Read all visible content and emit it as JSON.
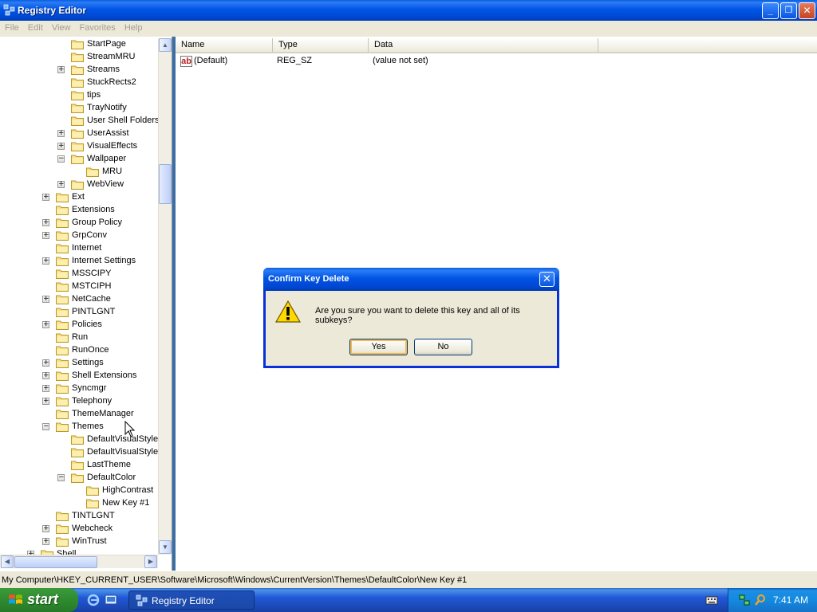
{
  "window": {
    "title": "Registry Editor",
    "minimize": "_",
    "maximize": "❐",
    "close": "✕"
  },
  "menu": [
    "File",
    "Edit",
    "View",
    "Favorites",
    "Help"
  ],
  "tree": [
    {
      "label": "StartPage",
      "indent": 2,
      "expander": ""
    },
    {
      "label": "StreamMRU",
      "indent": 2,
      "expander": ""
    },
    {
      "label": "Streams",
      "indent": 2,
      "expander": "+"
    },
    {
      "label": "StuckRects2",
      "indent": 2,
      "expander": ""
    },
    {
      "label": "tips",
      "indent": 2,
      "expander": ""
    },
    {
      "label": "TrayNotify",
      "indent": 2,
      "expander": ""
    },
    {
      "label": "User Shell Folders",
      "indent": 2,
      "expander": ""
    },
    {
      "label": "UserAssist",
      "indent": 2,
      "expander": "+"
    },
    {
      "label": "VisualEffects",
      "indent": 2,
      "expander": "+"
    },
    {
      "label": "Wallpaper",
      "indent": 2,
      "expander": "−"
    },
    {
      "label": "MRU",
      "indent": 3,
      "expander": ""
    },
    {
      "label": "WebView",
      "indent": 2,
      "expander": "+"
    },
    {
      "label": "Ext",
      "indent": 1,
      "expander": "+"
    },
    {
      "label": "Extensions",
      "indent": 1,
      "expander": ""
    },
    {
      "label": "Group Policy",
      "indent": 1,
      "expander": "+"
    },
    {
      "label": "GrpConv",
      "indent": 1,
      "expander": "+"
    },
    {
      "label": "Internet",
      "indent": 1,
      "expander": ""
    },
    {
      "label": "Internet Settings",
      "indent": 1,
      "expander": "+"
    },
    {
      "label": "MSSCIPY",
      "indent": 1,
      "expander": ""
    },
    {
      "label": "MSTCIPH",
      "indent": 1,
      "expander": ""
    },
    {
      "label": "NetCache",
      "indent": 1,
      "expander": "+"
    },
    {
      "label": "PINTLGNT",
      "indent": 1,
      "expander": ""
    },
    {
      "label": "Policies",
      "indent": 1,
      "expander": "+"
    },
    {
      "label": "Run",
      "indent": 1,
      "expander": ""
    },
    {
      "label": "RunOnce",
      "indent": 1,
      "expander": ""
    },
    {
      "label": "Settings",
      "indent": 1,
      "expander": "+"
    },
    {
      "label": "Shell Extensions",
      "indent": 1,
      "expander": "+"
    },
    {
      "label": "Syncmgr",
      "indent": 1,
      "expander": "+"
    },
    {
      "label": "Telephony",
      "indent": 1,
      "expander": "+"
    },
    {
      "label": "ThemeManager",
      "indent": 1,
      "expander": ""
    },
    {
      "label": "Themes",
      "indent": 1,
      "expander": "−"
    },
    {
      "label": "DefaultVisualStyleOff",
      "indent": 2,
      "expander": ""
    },
    {
      "label": "DefaultVisualStyleOn",
      "indent": 2,
      "expander": ""
    },
    {
      "label": "LastTheme",
      "indent": 2,
      "expander": ""
    },
    {
      "label": "DefaultColor",
      "indent": 2,
      "expander": "−"
    },
    {
      "label": "HighContrast",
      "indent": 3,
      "expander": ""
    },
    {
      "label": "New Key #1",
      "indent": 3,
      "expander": "",
      "selected": true
    },
    {
      "label": "TINTLGNT",
      "indent": 1,
      "expander": ""
    },
    {
      "label": "Webcheck",
      "indent": 1,
      "expander": "+"
    },
    {
      "label": "WinTrust",
      "indent": 1,
      "expander": "+"
    },
    {
      "label": "Shell",
      "indent": 0,
      "expander": "+"
    }
  ],
  "list": {
    "columns": [
      "Name",
      "Type",
      "Data"
    ],
    "rows": [
      {
        "name": "(Default)",
        "type": "REG_SZ",
        "data": "(value not set)",
        "icon": "ab"
      }
    ]
  },
  "status": "My Computer\\HKEY_CURRENT_USER\\Software\\Microsoft\\Windows\\CurrentVersion\\Themes\\DefaultColor\\New Key #1",
  "dialog": {
    "title": "Confirm Key Delete",
    "message": "Are you sure you want to delete this key and all of its subkeys?",
    "yes": "Yes",
    "no": "No",
    "close": "✕"
  },
  "taskbar": {
    "start": "start",
    "task": "Registry Editor",
    "clock": "7:41 AM"
  }
}
